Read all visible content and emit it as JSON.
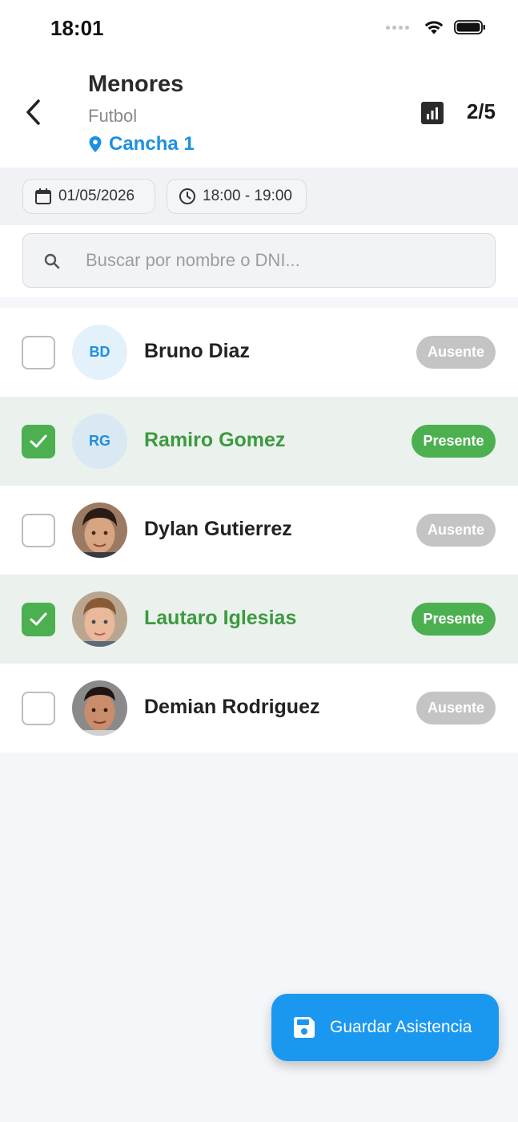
{
  "status_bar": {
    "time": "18:01"
  },
  "header": {
    "title": "Menores",
    "subtitle": "Futbol",
    "location": "Cancha 1",
    "count": "2/5"
  },
  "filters": {
    "date": "01/05/2026",
    "time_range": "18:00 - 19:00"
  },
  "search": {
    "placeholder": "Buscar por nombre o DNI...",
    "value": ""
  },
  "students": [
    {
      "name": "Bruno Diaz",
      "initials": "BD",
      "status": "Ausente",
      "checked": false
    },
    {
      "name": "Ramiro Gomez",
      "initials": "RG",
      "status": "Presente",
      "checked": true
    },
    {
      "name": "Dylan Gutierrez",
      "initials": "",
      "status": "Ausente",
      "checked": false
    },
    {
      "name": "Lautaro Iglesias",
      "initials": "",
      "status": "Presente",
      "checked": true
    },
    {
      "name": "Demian Rodriguez",
      "initials": "",
      "status": "Ausente",
      "checked": false
    }
  ],
  "save_button": {
    "label": "Guardar Asistencia"
  },
  "colors": {
    "accent": "#1e8fe1",
    "present_green": "#4caf50",
    "absent_gray": "#c4c4c4",
    "fab_blue": "#1a98f0"
  },
  "icons": {
    "back": "chevron-left-icon",
    "stats": "bar-chart-icon",
    "location": "location-pin-icon",
    "date": "calendar-icon",
    "time": "clock-icon",
    "search": "search-icon",
    "save": "floppy-disk-icon"
  }
}
